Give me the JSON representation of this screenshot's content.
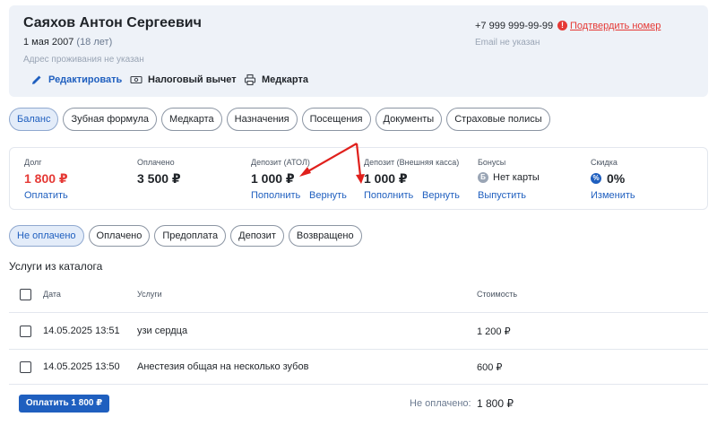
{
  "patient": {
    "name": "Саяхов Антон Сергеевич",
    "birth_date": "1 мая 2007",
    "age": "(18 лет)",
    "address": "Адрес проживания не указан",
    "phone": "+7 999 999-99-99",
    "confirm_phone": "Подтвердить номер",
    "email": "Email не указан"
  },
  "actions": {
    "edit": "Редактировать",
    "tax": "Налоговый вычет",
    "medcard": "Медкарта"
  },
  "tabs": [
    {
      "label": "Баланс",
      "active": true
    },
    {
      "label": "Зубная формула"
    },
    {
      "label": "Медкарта"
    },
    {
      "label": "Назначения"
    },
    {
      "label": "Посещения"
    },
    {
      "label": "Документы"
    },
    {
      "label": "Страховые полисы"
    }
  ],
  "balance": {
    "debt": {
      "label": "Долг",
      "value": "1 800 ₽",
      "link": "Оплатить"
    },
    "paid": {
      "label": "Оплачено",
      "value": "3 500 ₽"
    },
    "deposit_atol": {
      "label": "Депозит (АТОЛ)",
      "value": "1 000 ₽",
      "link1": "Пополнить",
      "link2": "Вернуть"
    },
    "deposit_ext": {
      "label": "Депозит (Внешняя касса)",
      "value": "1 000 ₽",
      "link1": "Пополнить",
      "link2": "Вернуть"
    },
    "bonus": {
      "label": "Бонусы",
      "value": "Нет карты",
      "link": "Выпустить",
      "icon_letter": "Б"
    },
    "discount": {
      "label": "Скидка",
      "value": "0%",
      "link": "Изменить",
      "icon_letter": "%"
    }
  },
  "filters": [
    {
      "label": "Не оплачено",
      "active": true
    },
    {
      "label": "Оплачено"
    },
    {
      "label": "Предоплата"
    },
    {
      "label": "Депозит"
    },
    {
      "label": "Возвращено"
    }
  ],
  "services": {
    "title": "Услуги из каталога",
    "columns": {
      "date": "Дата",
      "service": "Услуги",
      "cost": "Стоимость"
    },
    "rows": [
      {
        "date": "14.05.2025 13:51",
        "service": "узи сердца",
        "cost": "1 200 ₽"
      },
      {
        "date": "14.05.2025 13:50",
        "service": "Анестезия общая на несколько зубов",
        "cost": "600 ₽"
      }
    ]
  },
  "footer": {
    "pay_button": "Оплатить 1 800 ₽",
    "unpaid_label": "Не оплачено:",
    "unpaid_value": "1 800 ₽"
  },
  "colors": {
    "accent": "#1f5fbf",
    "danger": "#e53935",
    "annotation_arrow": "#e0201c"
  }
}
